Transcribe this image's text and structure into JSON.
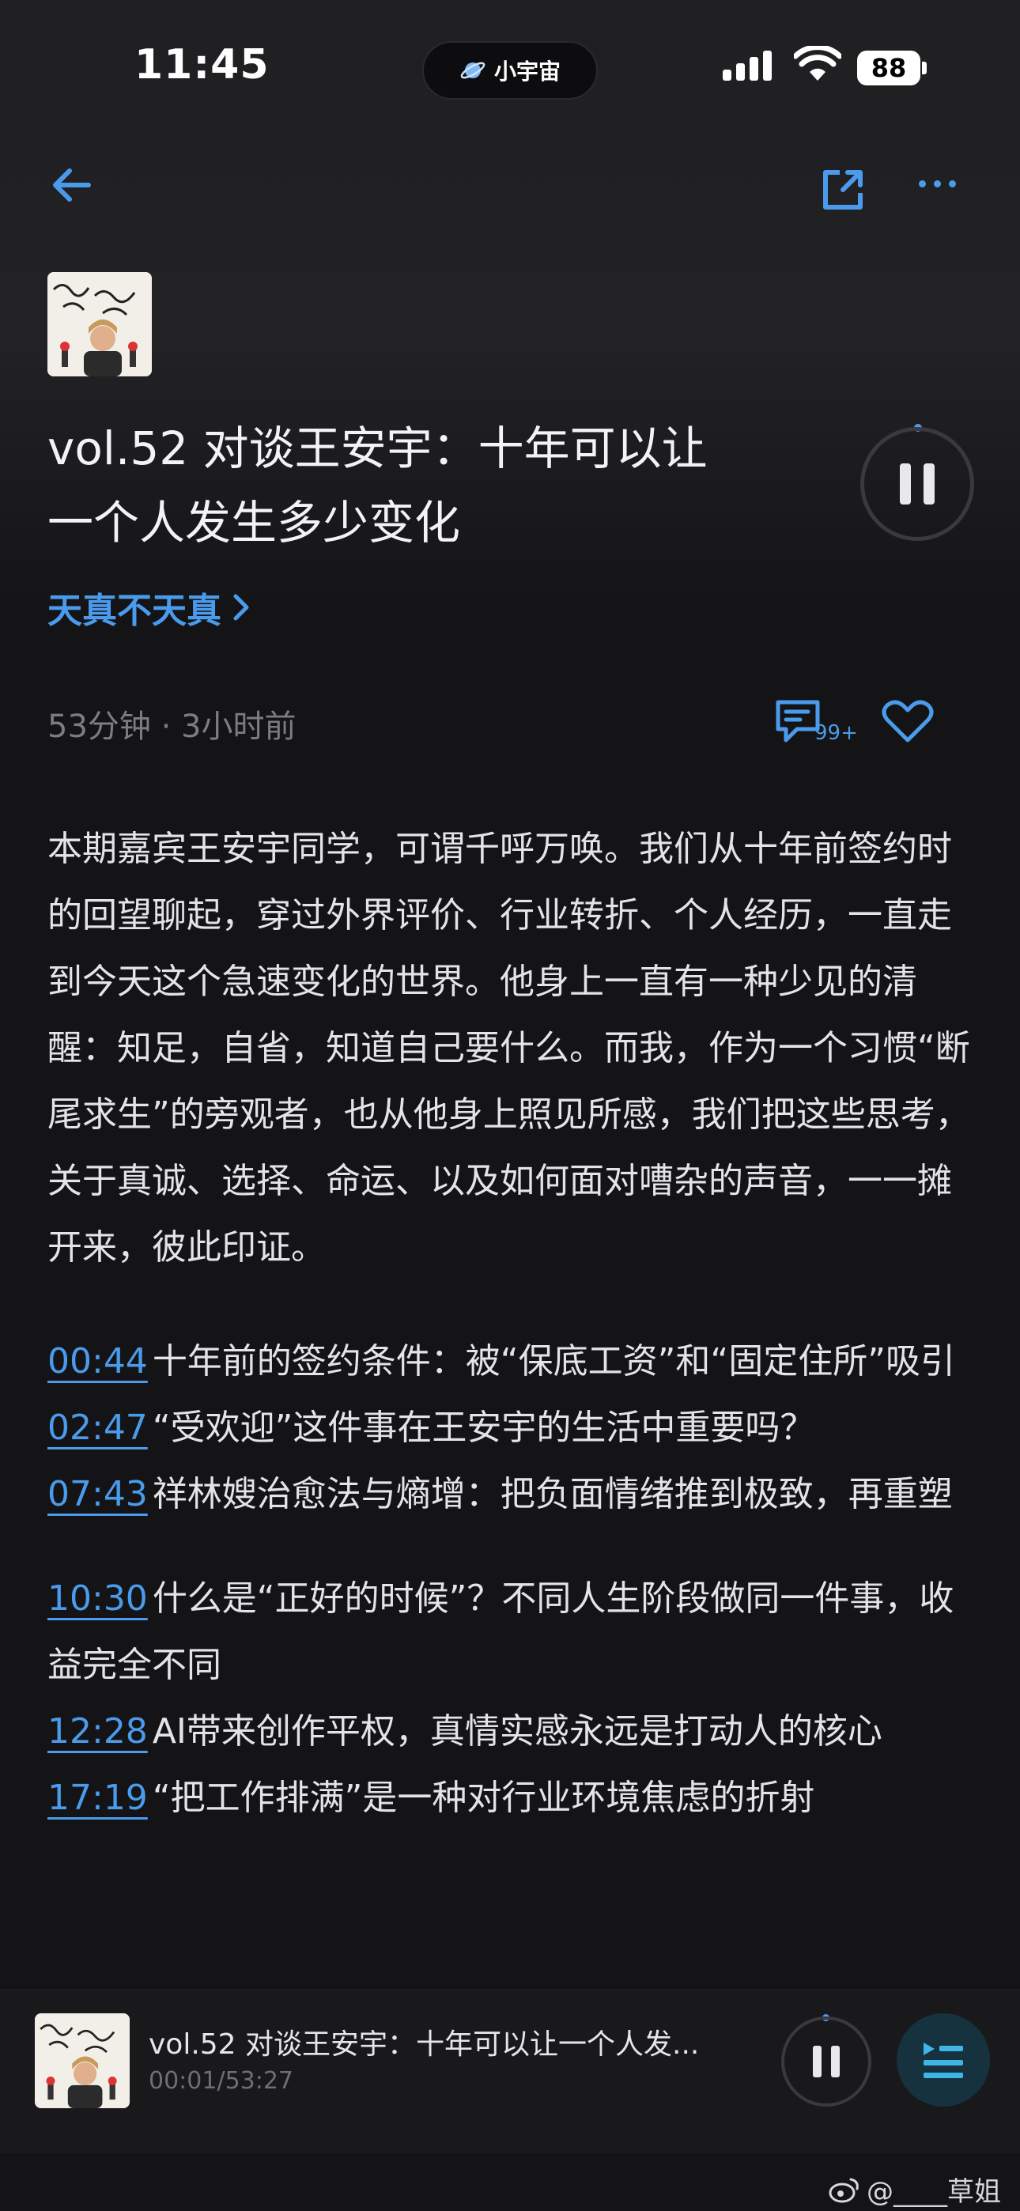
{
  "status_bar": {
    "time": "11:45",
    "island_label": "小宇宙",
    "battery": "88"
  },
  "nav": {
    "back_icon": "arrow-left-icon",
    "share_icon": "share-icon",
    "more_icon": "more-dots-icon"
  },
  "episode": {
    "title_line1": "vol.52 对谈王安宇：十年可以让",
    "title_line2": "一个人发生多少变化",
    "podcast_name": "天真不天真",
    "meta": "53分钟 · 3小时前",
    "comment_count": "99+",
    "description": "本期嘉宾王安宇同学，可谓千呼万唤。我们从十年前签约时的回望聊起，穿过外界评价、行业转折、个人经历，一直走到今天这个急速变化的世界。他身上一直有一种少见的清醒：知足，自省，知道自己要什么。而我，作为一个习惯“断尾求生”的旁观者，也从他身上照见所感，我们把这些思考，关于真诚、选择、命运、以及如何面对嘈杂的声音，一一摊开来，彼此印证。"
  },
  "chapters": [
    {
      "time": "00:44",
      "text": "十年前的签约条件：被“保底工资”和“固定住所”吸引"
    },
    {
      "time": "02:47",
      "text": "“受欢迎”这件事在王安宇的生活中重要吗？"
    },
    {
      "time": "07:43",
      "text": "祥林嫂治愈法与熵增：把负面情绪推到极致，再重塑"
    },
    {
      "time": "10:30",
      "text": "什么是“正好的时候”？不同人生阶段做同一件事，收益完全不同"
    },
    {
      "time": "12:28",
      "text": "AI带来创作平权，真情实感永远是打动人的核心"
    },
    {
      "time": "17:19",
      "text": "“把工作排满”是一种对行业环境焦虑的折射"
    }
  ],
  "mini_player": {
    "title": "vol.52 对谈王安宇：十年可以让一个人发...",
    "progress": "00:01/53:27",
    "progress_fraction": 0.0003
  },
  "watermark": "@____草姐",
  "colors": {
    "accent": "#4b9bec",
    "background": "#141416",
    "text": "#e4e4e6",
    "muted": "#7c7c82"
  }
}
